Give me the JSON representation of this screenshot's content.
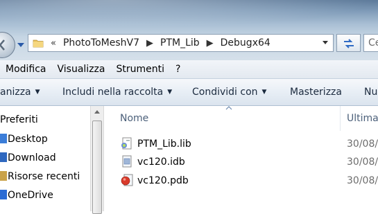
{
  "address": {
    "overflow": "«",
    "crumbs": [
      "PhotoToMeshV7",
      "PTM_Lib",
      "Debugx64"
    ],
    "search_placeholder": "Ce"
  },
  "menu": [
    "Modifica",
    "Visualizza",
    "Strumenti",
    "?"
  ],
  "commands": {
    "organize": "anizza",
    "library": "Includi nella raccolta",
    "share": "Condividi con",
    "burn": "Masterizza",
    "more": "Nu"
  },
  "nav": {
    "favorites": "Preferiti",
    "items": [
      "Desktop",
      "Download",
      "Risorse recenti",
      "OneDrive"
    ]
  },
  "columns": {
    "name": "Nome",
    "modified": "Ultima"
  },
  "files": [
    {
      "name": "PTM_Lib.lib",
      "date": "30/08/",
      "icon": "lib-file-icon"
    },
    {
      "name": "vc120.idb",
      "date": "30/08/",
      "icon": "idb-file-icon"
    },
    {
      "name": "vc120.pdb",
      "date": "30/08/",
      "icon": "pdb-file-icon"
    }
  ],
  "colors": {
    "header_text": "#4c607a",
    "date_text": "#6d6d6d",
    "command_bg": "#e9eff6"
  }
}
